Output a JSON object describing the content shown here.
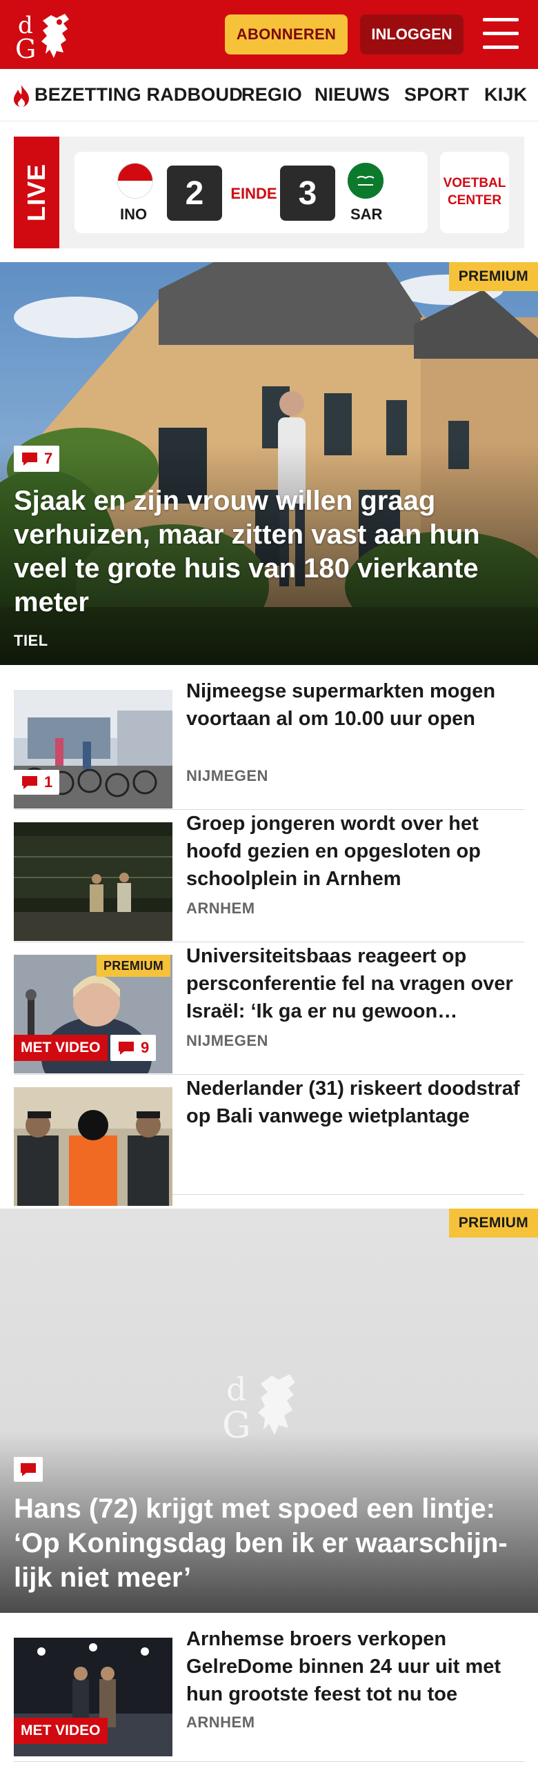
{
  "header": {
    "logo_alt": "dG",
    "subscribe_label": "ABONNEREN",
    "login_label": "INLOGGEN",
    "menu_icon": "hamburger-icon"
  },
  "nav": {
    "items": [
      "BEZETTING RADBOUD",
      "REGIO",
      "NIEUWS",
      "SPORT",
      "KIJK"
    ]
  },
  "live": {
    "label": "LIVE",
    "home_code": "INO",
    "home_score": "2",
    "status": "EINDE",
    "away_score": "3",
    "away_code": "SAR",
    "center_label": "VOETBAL CENTER"
  },
  "hero": {
    "premium": "PREMIUM",
    "comments": "7",
    "title": "Sjaak en zijn vrouw willen graag verhuizen, maar zitten vast aan hun veel te grote huis van 180 vierkante meter",
    "location": "TIEL"
  },
  "articles": [
    {
      "title": "Nijmeegse supermarkten mogen voortaan al om 10.00 uur open",
      "location": "NIJMEGEN",
      "comments": "1"
    },
    {
      "title": "Groep jongeren wordt over het hoofd gezien en opgesloten op schoolplein in Arnhem",
      "location": "ARNHEM"
    },
    {
      "title": "Universiteitsbaas reageert op persconferentie fel na vragen over Israël: ‘Ik ga er nu gewoon…",
      "location": "NIJMEGEN",
      "premium": "PREMIUM",
      "video": "MET VIDEO",
      "comments": "9"
    },
    {
      "title": "Nederlander (31) riskeert doodstraf op Bali vanwege wietplantage",
      "location": ""
    }
  ],
  "hero2": {
    "premium": "PREMIUM",
    "title": "Hans (72) krijgt met spoed een lintje: ‘Op Koningsdag ben ik er waarschijn-lijk niet meer’"
  },
  "article5": {
    "title": "Arnhemse broers verkopen GelreDome binnen 24 uur uit met hun grootste feest tot nu toe",
    "location": "ARNHEM",
    "video": "MET VIDEO"
  },
  "colors": {
    "brand_red": "#d10a11",
    "premium_yellow": "#f6c23a"
  }
}
